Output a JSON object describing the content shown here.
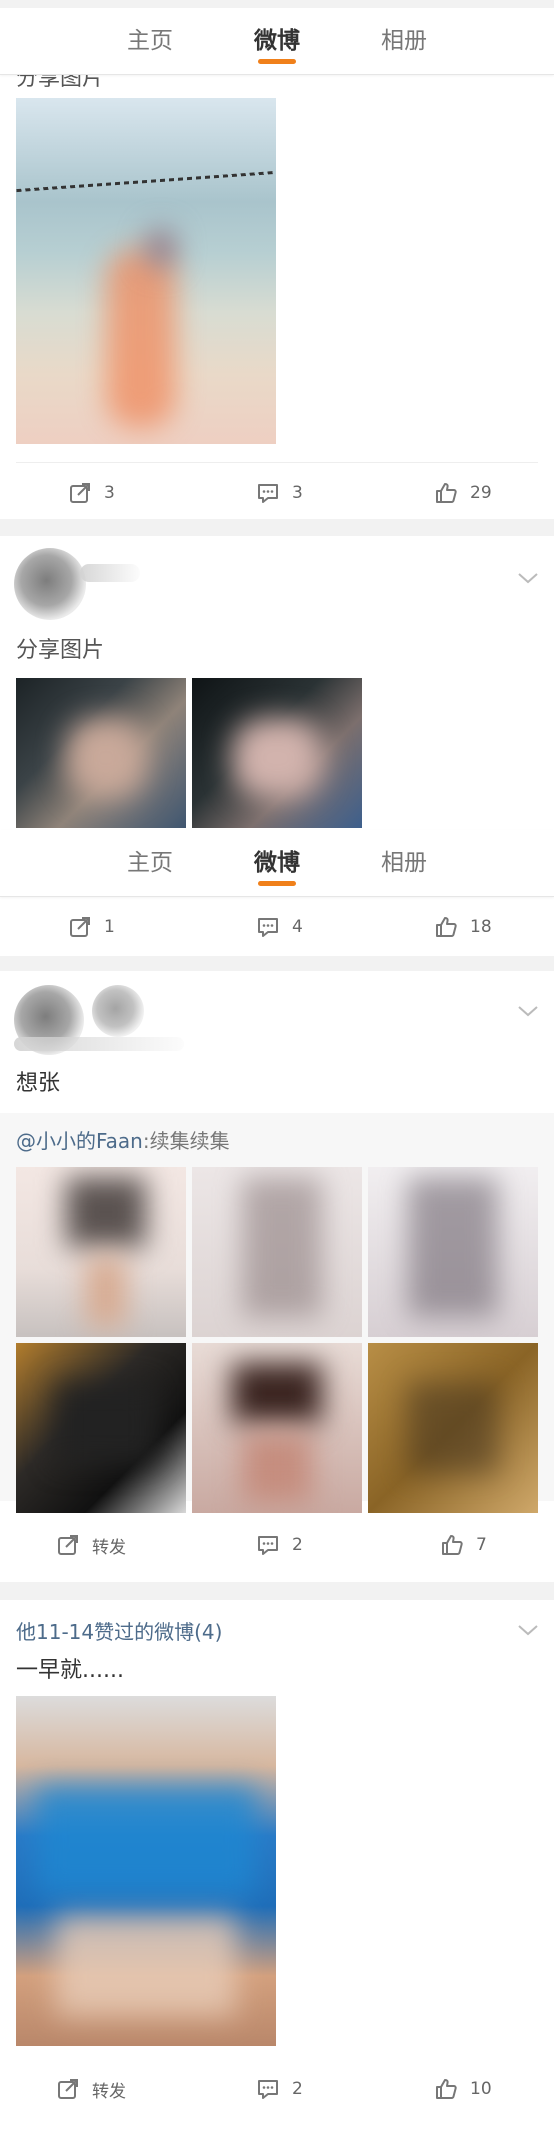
{
  "tabs": [
    "主页",
    "微博",
    "相册"
  ],
  "active_tab": "微博",
  "post1": {
    "text": "分享图片",
    "actions": {
      "repost": "3",
      "comment": "3",
      "like": "29"
    }
  },
  "post2": {
    "text": "分享图片",
    "actions": {
      "repost": "1",
      "comment": "4",
      "like": "18"
    }
  },
  "post3": {
    "text": "想张",
    "retweet_author": "@小小的Faan",
    "retweet_text": ":续集续集",
    "actions": {
      "repost": "转发",
      "comment": "2",
      "like": "7"
    }
  },
  "post4": {
    "header": "他11-14赞过的微博(4)",
    "text": "一早就......",
    "actions": {
      "repost": "转发",
      "comment": "2",
      "like": "10"
    }
  },
  "colors": {
    "accent": "#f0801a",
    "link": "#4d6b8a",
    "background": "#f2f2f2"
  }
}
